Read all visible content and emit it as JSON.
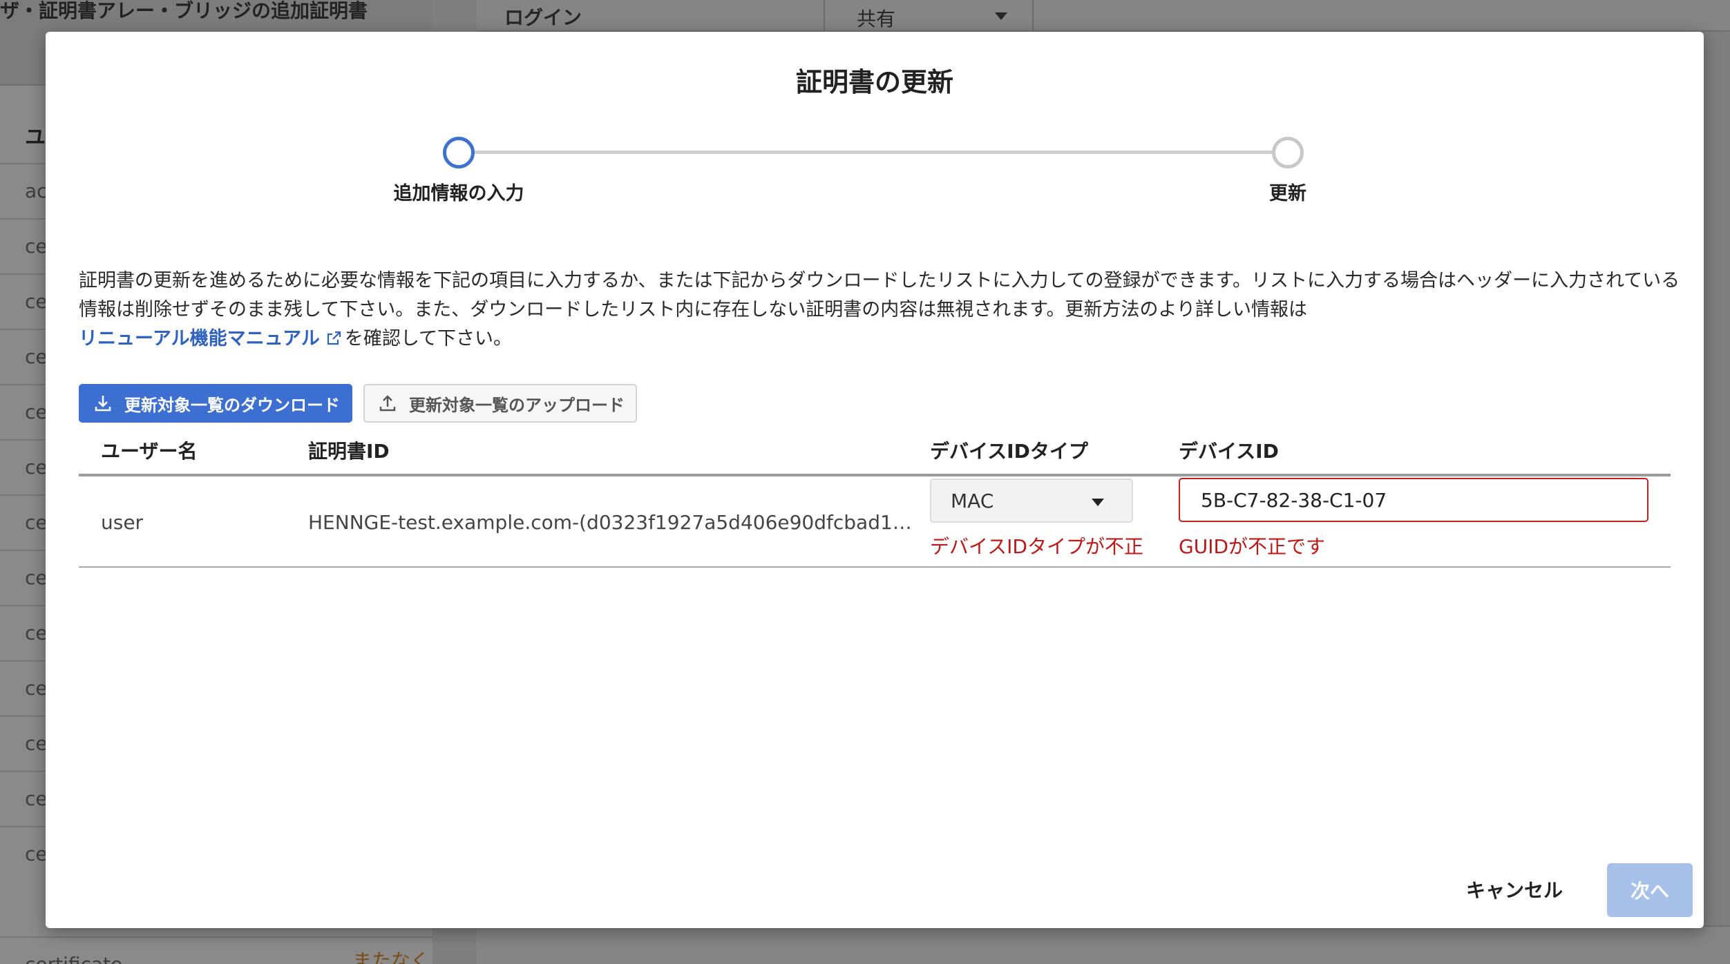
{
  "background": {
    "top_text": "ザ・証明書アレー・ブリッジの追加証明書",
    "column_header": "ユ",
    "rows": [
      "ac",
      "ce",
      "ce",
      "ce",
      "ce",
      "ce",
      "ce",
      "ce",
      "ce",
      "ce",
      "ce",
      "ce",
      "ce",
      "ce"
    ],
    "bottom_left": "certificate",
    "bottom_orange": "またなく",
    "login_label": "ログイン",
    "share_select": "共有"
  },
  "modal": {
    "title": "証明書の更新",
    "stepper": {
      "steps": [
        {
          "label": "追加情報の入力",
          "state": "active"
        },
        {
          "label": "更新",
          "state": "inactive"
        }
      ]
    },
    "description": {
      "text_before_link": "証明書の更新を進めるために必要な情報を下記の項目に入力するか、または下記からダウンロードしたリストに入力しての登録ができます。リストに入力する場合はヘッダーに入力されている情報は削除せずそのまま残して下さい。また、ダウンロードしたリスト内に存在しない証明書の内容は無視されます。更新方法のより詳しい情報は",
      "link_text": "リニューアル機能マニュアル",
      "text_after_link": "を確認して下さい。"
    },
    "buttons": {
      "download": "更新対象一覧のダウンロード",
      "upload": "更新対象一覧のアップロード",
      "cancel": "キャンセル",
      "next": "次へ"
    },
    "table": {
      "headers": [
        "ユーザー名",
        "証明書ID",
        "デバイスIDタイプ",
        "デバイスID"
      ],
      "rows": [
        {
          "username": "user",
          "certificate_id": "HENNGE-test.example.com-(d0323f1927a5d406e90dfcbad103...",
          "device_id_type": "MAC",
          "device_id": "5B-C7-82-38-C1-07",
          "device_id_type_error": "デバイスIDタイプが不正",
          "device_id_error": "GUIDが不正です"
        }
      ]
    }
  },
  "colors": {
    "accent": "#3c6fd1",
    "link": "#2f63c0",
    "error": "#c01616",
    "next_disabled": "#a8c1ea"
  }
}
